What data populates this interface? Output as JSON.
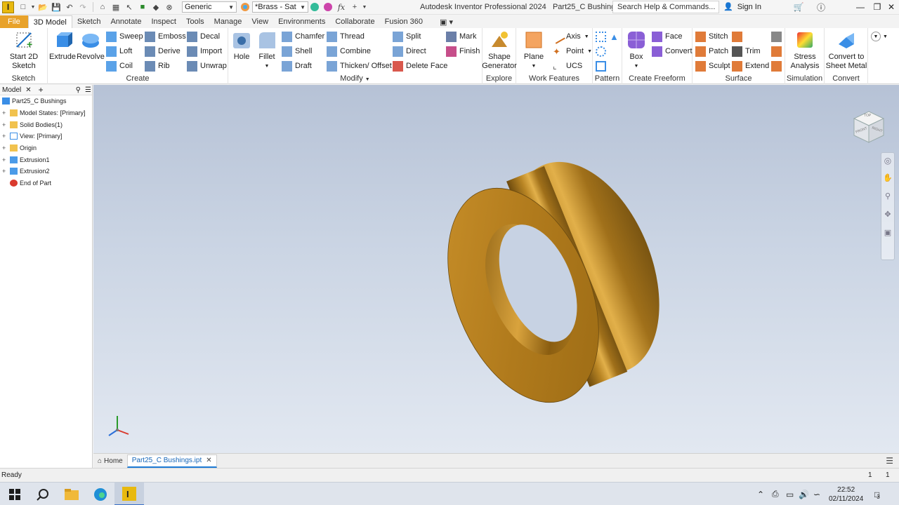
{
  "window": {
    "app_logo": "I",
    "title": "Autodesk Inventor Professional 2024",
    "document": "Part25_C Bushings",
    "appearance_dropdown": "Generic",
    "material_dropdown": "*Brass - Sat",
    "search_placeholder": "Search Help & Commands...",
    "sign_in": "Sign In"
  },
  "tabs": [
    "File",
    "3D Model",
    "Sketch",
    "Annotate",
    "Inspect",
    "Tools",
    "Manage",
    "View",
    "Environments",
    "Collaborate",
    "Fusion 360"
  ],
  "ribbon": {
    "sketch": {
      "title": "Sketch",
      "start_sketch": "Start 2D Sketch"
    },
    "create": {
      "title": "Create",
      "extrude": "Extrude",
      "revolve": "Revolve",
      "sweep": "Sweep",
      "loft": "Loft",
      "coil": "Coil",
      "emboss": "Emboss",
      "derive": "Derive",
      "rib": "Rib",
      "decal": "Decal",
      "import": "Import",
      "unwrap": "Unwrap"
    },
    "modify": {
      "title": "Modify",
      "hole": "Hole",
      "fillet": "Fillet",
      "chamfer": "Chamfer",
      "shell": "Shell",
      "draft": "Draft",
      "thread": "Thread",
      "combine": "Combine",
      "thicken": "Thicken/ Offset",
      "split": "Split",
      "direct": "Direct",
      "delete_face": "Delete Face",
      "mark": "Mark",
      "finish": "Finish"
    },
    "explore": {
      "title": "Explore",
      "shape_generator": "Shape Generator"
    },
    "work_features": {
      "title": "Work Features",
      "plane": "Plane",
      "axis": "Axis",
      "point": "Point",
      "ucs": "UCS"
    },
    "pattern": {
      "title": "Pattern"
    },
    "create_freeform": {
      "title": "Create Freeform",
      "box": "Box",
      "face": "Face",
      "convert": "Convert"
    },
    "surface": {
      "title": "Surface",
      "stitch": "Stitch",
      "patch": "Patch",
      "sculpt": "Sculpt",
      "trim": "Trim",
      "extend": "Extend"
    },
    "simulation": {
      "title": "Simulation",
      "stress": "Stress Analysis"
    },
    "convert": {
      "title": "Convert",
      "sheet_metal": "Convert to Sheet Metal"
    }
  },
  "browser": {
    "tab": "Model",
    "items": [
      {
        "label": "Part25_C Bushings",
        "icon": "part-icon"
      },
      {
        "label": "Model States: [Primary]",
        "icon": "folder-icon"
      },
      {
        "label": "Solid Bodies(1)",
        "icon": "folder-icon"
      },
      {
        "label": "View: [Primary]",
        "icon": "view-icon"
      },
      {
        "label": "Origin",
        "icon": "folder-icon"
      },
      {
        "label": "Extrusion1",
        "icon": "extrusion-icon"
      },
      {
        "label": "Extrusion2",
        "icon": "extrusion-icon"
      },
      {
        "label": "End of Part",
        "icon": "end-of-part-icon"
      }
    ]
  },
  "viewcube": {
    "top": "TOP",
    "front": "FRONT",
    "right": "RIGHT"
  },
  "doc_tabs": {
    "home": "Home",
    "active": "Part25_C Bushings.ipt"
  },
  "status": {
    "text": "Ready",
    "count1": "1",
    "count2": "1"
  },
  "taskbar": {
    "time": "22:52",
    "date": "02/11/2024",
    "notifications": "3"
  },
  "colors": {
    "accent": "#e8a22a",
    "brass": "#b8860b",
    "viewport_top": "#b6c2d6"
  }
}
